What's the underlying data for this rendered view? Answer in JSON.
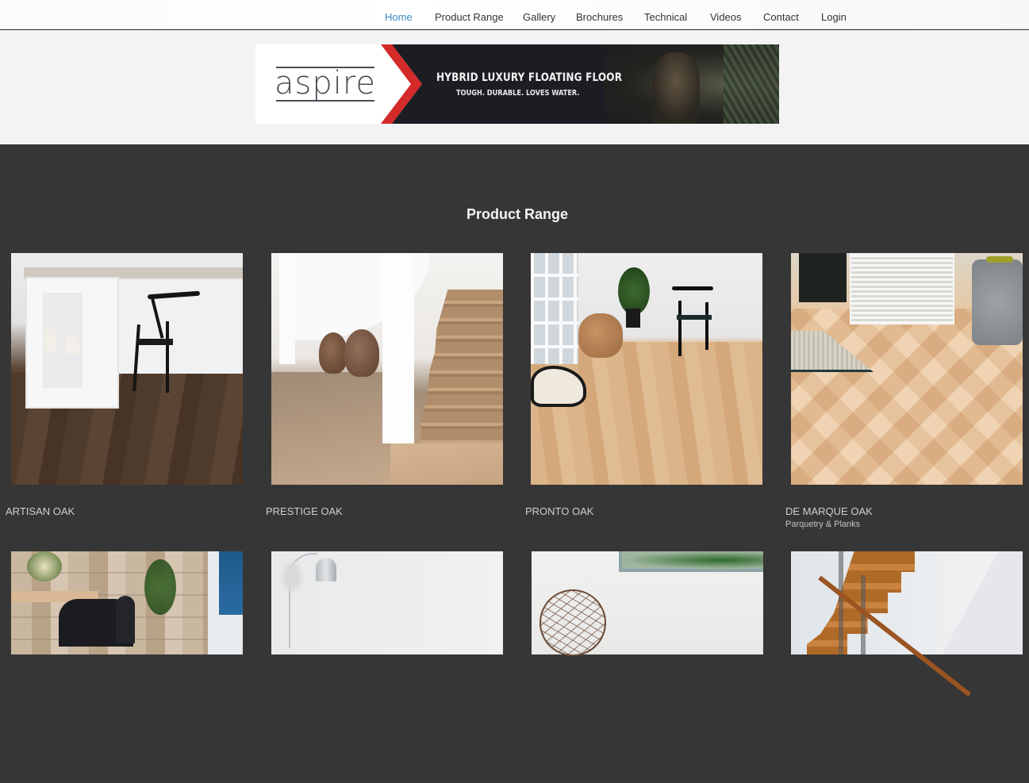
{
  "nav": {
    "items": [
      {
        "label": "Home",
        "active": true
      },
      {
        "label": "Product Range",
        "active": false
      },
      {
        "label": "Gallery",
        "active": false
      },
      {
        "label": "Brochures",
        "active": false
      },
      {
        "label": "Technical",
        "active": false
      },
      {
        "label": "Videos",
        "active": false
      },
      {
        "label": "Contact",
        "active": false
      },
      {
        "label": "Login",
        "active": false
      }
    ],
    "active_color": "#3c88c4"
  },
  "banner": {
    "logo": "aspire",
    "headline": "HYBRID LUXURY FLOATING FLOOR",
    "tagline": "TOUGH. DURABLE. LOVES WATER.",
    "accent_color": "#d42a2a"
  },
  "section": {
    "title": "Product Range"
  },
  "products": [
    {
      "name": "ARTISAN OAK",
      "subtitle": "",
      "image": "dark oak floor kitchen island with black chair"
    },
    {
      "name": "PRESTIGE OAK",
      "subtitle": "",
      "image": "oak staircase with clay vases"
    },
    {
      "name": "PRONTO OAK",
      "subtitle": "",
      "image": "light oak floor with chair and beanbag"
    },
    {
      "name": "DE MARQUE OAK",
      "subtitle": "Parquetry & Planks",
      "image": "herringbone oak floor with cabinet"
    },
    {
      "name": "",
      "subtitle": "",
      "image": "dining room with black chairs and stone wall"
    },
    {
      "name": "",
      "subtitle": "",
      "image": "white room with silver floor lamp"
    },
    {
      "name": "",
      "subtitle": "",
      "image": "wire sphere decor with plant window"
    },
    {
      "name": "",
      "subtitle": "",
      "image": "timber staircase with glass balustrade"
    }
  ]
}
